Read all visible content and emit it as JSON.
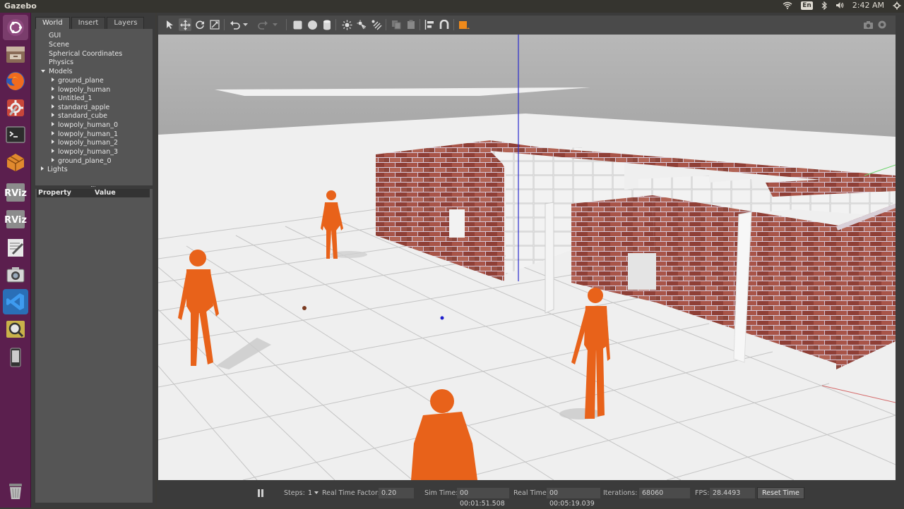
{
  "window": {
    "title": "Gazebo"
  },
  "tray": {
    "lang": "En",
    "volume_icon": "volume-icon",
    "wifi_icon": "wifi-icon",
    "time": "2:42 AM"
  },
  "launcher": {
    "items": [
      "ubuntu-dash",
      "files",
      "firefox",
      "system-settings",
      "terminal",
      "software-center",
      "rviz",
      "rviz-2",
      "text-editor",
      "screenshot",
      "vs-code",
      "image-viewer",
      "device",
      "trash"
    ]
  },
  "left_panel": {
    "tabs": [
      "World",
      "Insert",
      "Layers"
    ],
    "active_tab": "World",
    "tree": {
      "top": [
        "GUI",
        "Scene",
        "Spherical Coordinates",
        "Physics"
      ],
      "models_label": "Models",
      "models": [
        "ground_plane",
        "lowpoly_human",
        "Untitled_1",
        "standard_apple",
        "standard_cube",
        "lowpoly_human_0",
        "lowpoly_human_1",
        "lowpoly_human_2",
        "lowpoly_human_3",
        "ground_plane_0"
      ],
      "lights_label": "Lights"
    },
    "properties": {
      "col_property": "Property",
      "col_value": "Value"
    }
  },
  "toolbar": {
    "tools": [
      "select",
      "translate",
      "rotate",
      "scale",
      "undo",
      "redo",
      "box",
      "sphere",
      "cylinder",
      "point-light",
      "spot-light",
      "directional-light",
      "copy",
      "paste",
      "align",
      "snap",
      "change-view"
    ]
  },
  "status": {
    "steps_label": "Steps:",
    "steps_value": "1",
    "rtf_label": "Real Time Factor:",
    "rtf_value": "0.20",
    "sim_label": "Sim Time:",
    "sim_value": "00 00:01:51.508",
    "real_label": "Real Time:",
    "real_value": "00 00:05:19.039",
    "iter_label": "Iterations:",
    "iter_value": "68060",
    "fps_label": "FPS:",
    "fps_value": "28.4493",
    "reset_label": "Reset Time"
  },
  "colors": {
    "human": "#e8621a",
    "brick": "#9a4a3c",
    "interior_wall": "#e6e6e6",
    "launcher_bg": "#5b1f4e"
  }
}
